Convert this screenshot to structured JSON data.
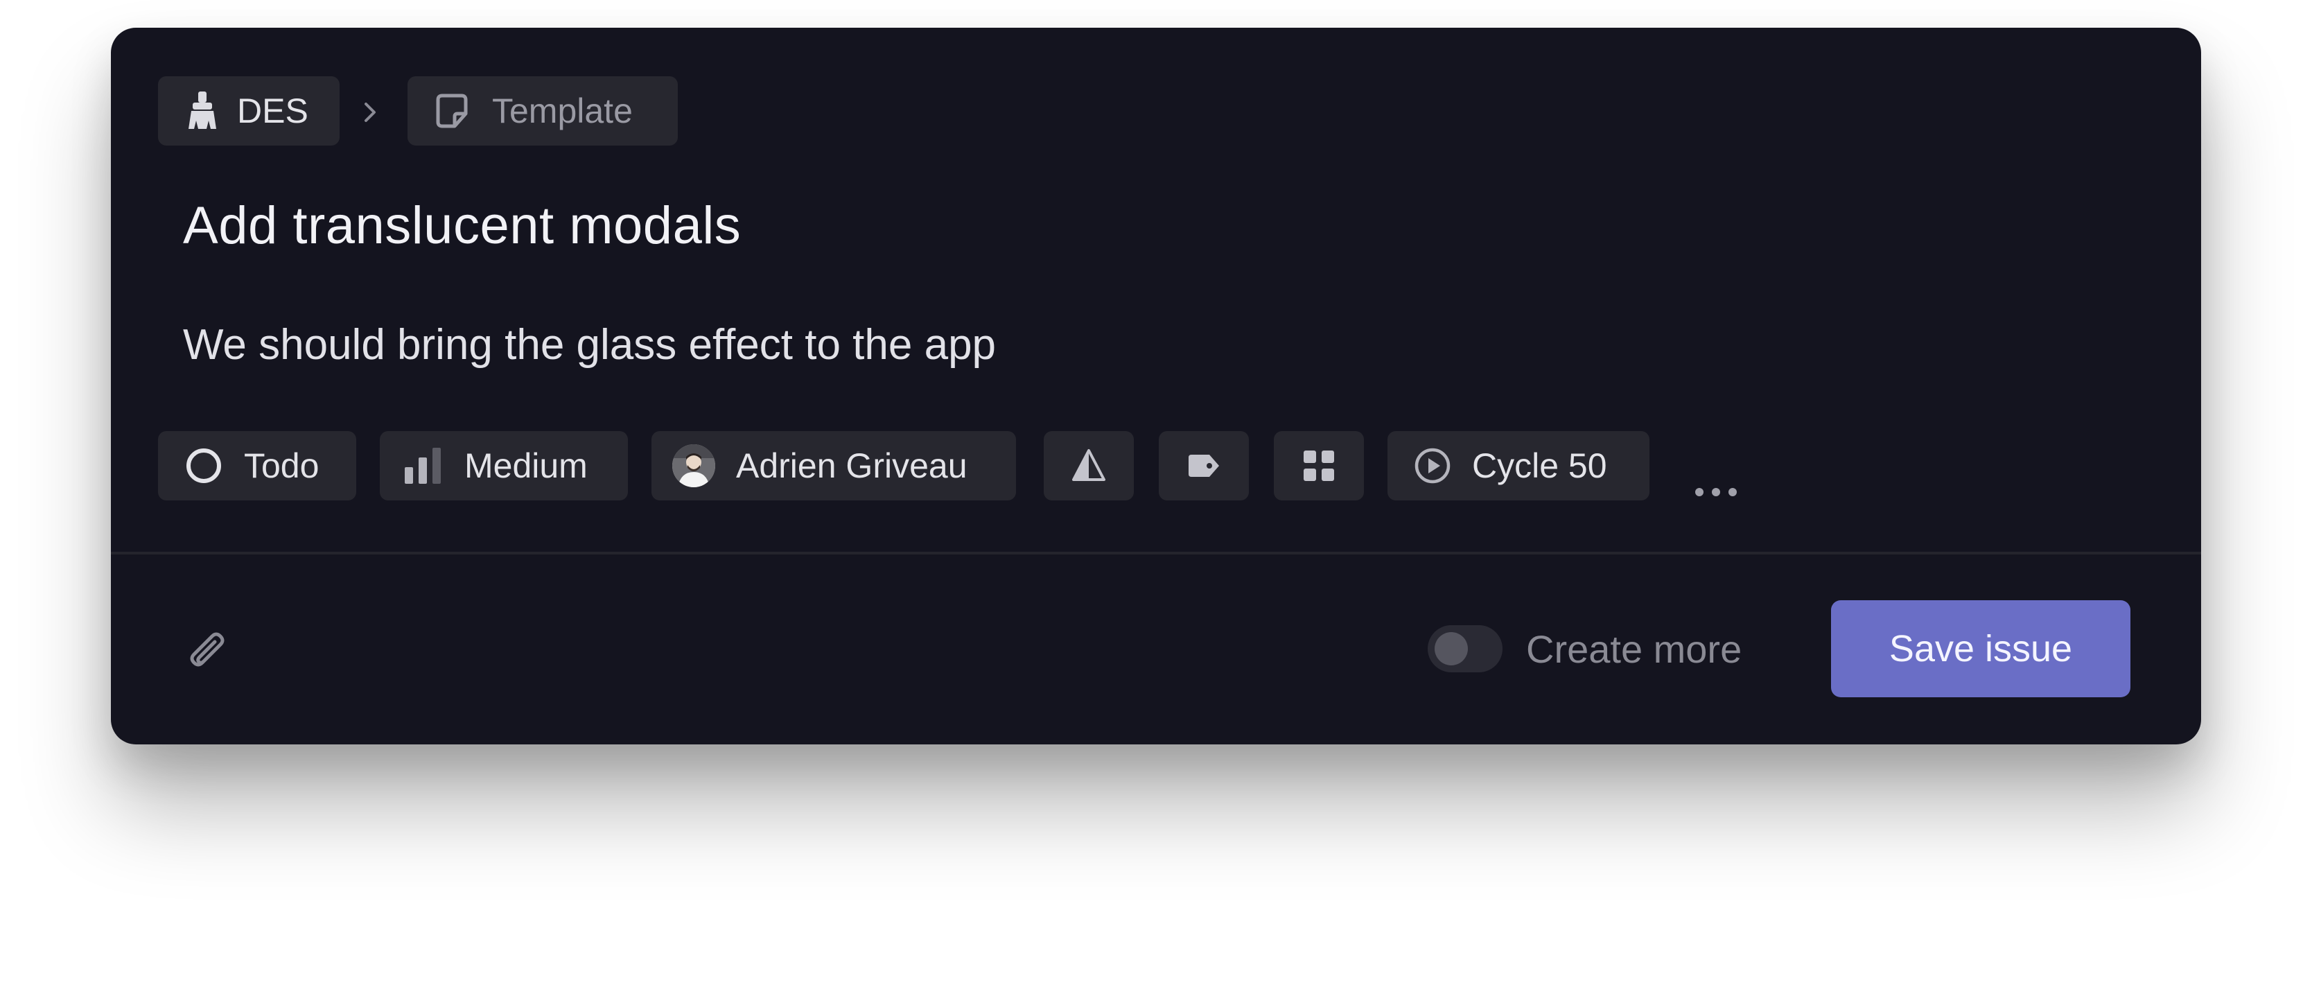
{
  "breadcrumb": {
    "team": {
      "label": "DES",
      "icon": "broom-icon"
    },
    "separator_icon": "chevron-right-icon",
    "template": {
      "label": "Template",
      "icon": "note-icon"
    }
  },
  "issue": {
    "title": "Add translucent modals",
    "description": "We should bring the glass effect to the app"
  },
  "properties": {
    "status": {
      "label": "Todo",
      "icon": "circle-status-icon"
    },
    "priority": {
      "label": "Medium",
      "icon": "signal-bars-icon"
    },
    "assignee": {
      "label": "Adrien Griveau",
      "icon": "avatar"
    },
    "estimate": {
      "icon": "triangle-estimate-icon"
    },
    "labels": {
      "icon": "tag-icon"
    },
    "project": {
      "icon": "grid-icon"
    },
    "cycle": {
      "label": "Cycle 50",
      "icon": "play-circle-icon"
    },
    "more": {
      "icon": "ellipsis-icon"
    }
  },
  "footer": {
    "attach_icon": "paperclip-icon",
    "create_more_label": "Create more",
    "create_more_enabled": false,
    "save_label": "Save issue"
  },
  "colors": {
    "modal_bg": "#14141f",
    "pill_bg": "#27272f",
    "accent": "#6a6ec6"
  }
}
